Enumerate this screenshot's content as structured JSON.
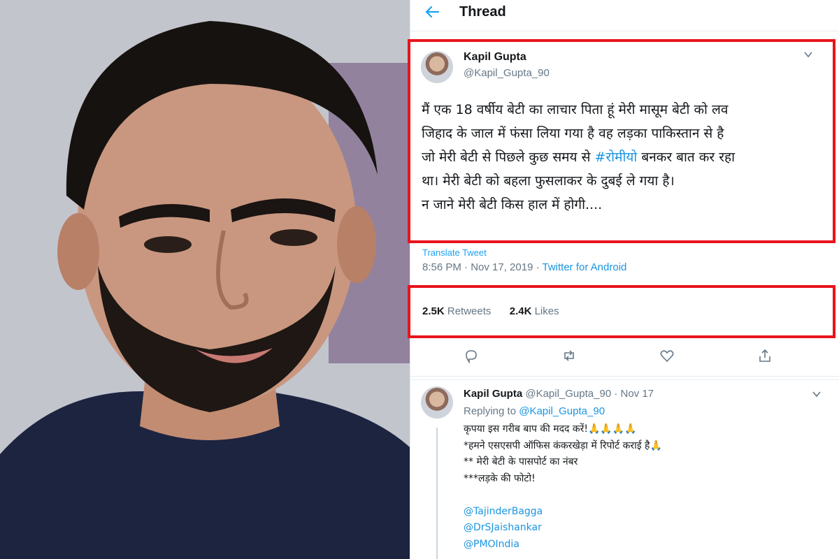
{
  "topbar": {
    "title": "Thread"
  },
  "tweet": {
    "author_name": "Kapil Gupta",
    "author_handle": "@Kapil_Gupta_90",
    "text_lines": [
      "मैं एक 18 वर्षीय बेटी का लाचार पिता हूं मेरी मासूम बेटी को लव",
      "जिहाद के जाल में फंसा लिया गया है वह लड़का पाकिस्तान से है",
      "जो मेरी बेटी से पिछले कुछ समय से ",
      "#रोमीयो",
      " बनकर बात कर रहा",
      "था। मेरी बेटी को बहला फुसलाकर के दुबई ले गया है।",
      "न जाने मेरी बेटी किस हाल में होगी...."
    ],
    "translate_label": "Translate Tweet",
    "time": "8:56 PM · Nov 17, 2019 · ",
    "source": "Twitter for Android",
    "retweets_count": "2.5K",
    "retweets_label": "Retweets",
    "likes_count": "2.4K",
    "likes_label": "Likes"
  },
  "actions": {
    "icons": [
      "reply-icon",
      "retweet-icon",
      "like-icon",
      "share-icon"
    ]
  },
  "reply": {
    "author_name": "Kapil Gupta",
    "author_meta": "@Kapil_Gupta_90 · Nov 17",
    "replying_prefix": "Replying to ",
    "replying_to": "@Kapil_Gupta_90",
    "lines": [
      "कृपया इस गरीब बाप की मदद करें!🙏🙏🙏🙏",
      "*हमने एसएसपी ऑफिस कंकरखेड़ा में रिपोर्ट कराई है🙏",
      "** मेरी बेटी के पासपोर्ट का नंबर",
      "***लड़के की फोटो!",
      "",
      "@TajinderBagga",
      "@DrSJaishankar",
      "@PMOIndia"
    ]
  },
  "colors": {
    "accent": "#1da1f2",
    "highlight_box": "#e8141b",
    "secondary_text": "#657786"
  }
}
